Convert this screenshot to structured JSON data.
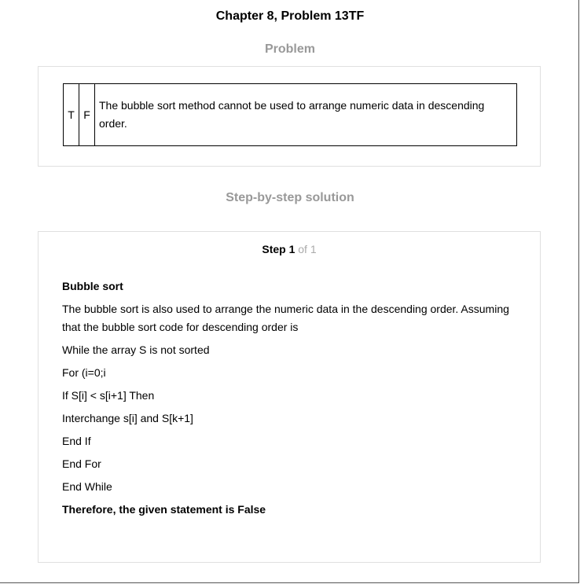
{
  "page": {
    "title": "Chapter 8, Problem 13TF"
  },
  "problem": {
    "heading": "Problem",
    "true_option": "T",
    "false_option": "F",
    "statement": "The bubble sort method cannot be used to arrange numeric data in descending order."
  },
  "solution": {
    "heading": "Step-by-step solution",
    "step_label": "Step 1",
    "step_of": "of 1",
    "subheading": "Bubble sort",
    "intro": "The bubble sort is also used to arrange the numeric data in the descending order. Assuming that the bubble sort code for descending order is",
    "code_lines": [
      "While the array S is not sorted",
      "For (i=0;i",
      "If S[i] < s[i+1] Then",
      "Interchange s[i] and S[k+1]",
      "End If",
      "End For",
      "End While"
    ],
    "conclusion": "Therefore, the given statement is False"
  }
}
